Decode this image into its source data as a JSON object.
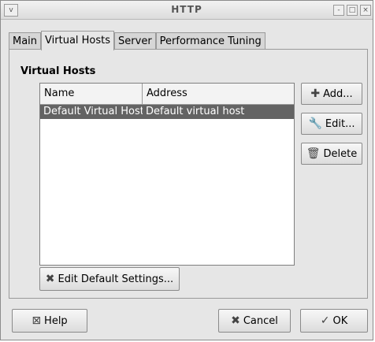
{
  "window": {
    "title": "HTTP",
    "menu_glyph": "v",
    "controls": [
      "-",
      "□",
      "×"
    ]
  },
  "tabs": [
    {
      "label": "Main"
    },
    {
      "label": "Virtual Hosts"
    },
    {
      "label": "Server"
    },
    {
      "label": "Performance Tuning"
    }
  ],
  "section": {
    "title": "Virtual Hosts"
  },
  "table": {
    "columns": [
      "Name",
      "Address"
    ],
    "rows": [
      {
        "name": "Default Virtual Host",
        "address": "Default virtual host"
      }
    ]
  },
  "buttons": {
    "add": {
      "label": "Add...",
      "icon": "plus-icon"
    },
    "edit": {
      "label": "Edit...",
      "icon": "wrench-icon"
    },
    "delete": {
      "label": "Delete",
      "icon": "trash-icon"
    },
    "edit_default": {
      "label": "Edit Default Settings...",
      "icon": "tools-icon"
    },
    "help": {
      "label": "Help",
      "icon": "help-icon"
    },
    "cancel": {
      "label": "Cancel",
      "icon": "cancel-icon"
    },
    "ok": {
      "label": "OK",
      "icon": "checkmark-icon"
    }
  }
}
